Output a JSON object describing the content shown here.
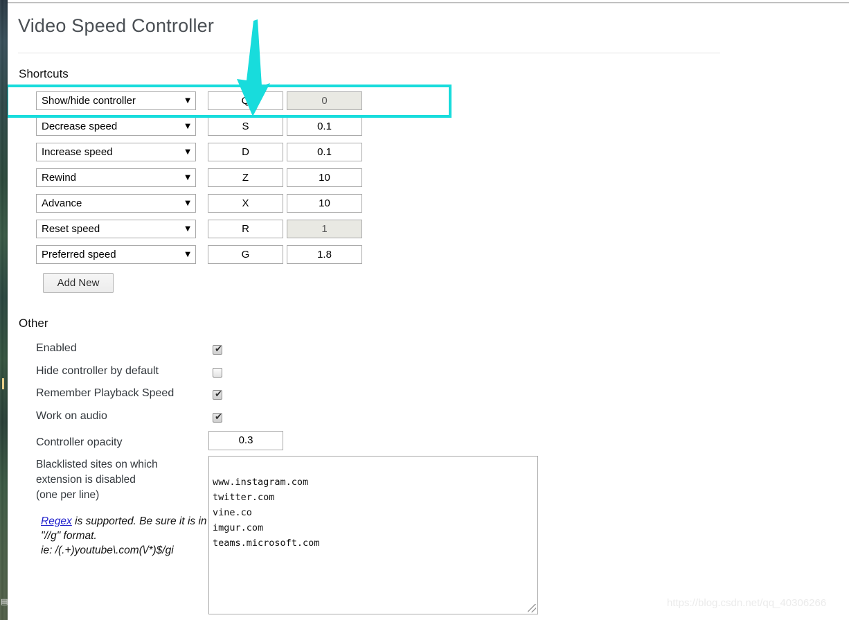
{
  "window": {
    "tab_indicator_color": "#ef5b25",
    "page_background": "#ffffff"
  },
  "header": {
    "title": "Video Speed Controller"
  },
  "sections": {
    "shortcuts_heading": "Shortcuts",
    "other_heading": "Other"
  },
  "shortcuts": {
    "add_new_label": "Add New",
    "caret_glyph": "▼",
    "rows": [
      {
        "action": "Show/hide controller",
        "key": "Q",
        "value": "0",
        "value_disabled": true,
        "highlighted": true
      },
      {
        "action": "Decrease speed",
        "key": "S",
        "value": "0.1",
        "value_disabled": false,
        "highlighted": false
      },
      {
        "action": "Increase speed",
        "key": "D",
        "value": "0.1",
        "value_disabled": false,
        "highlighted": false
      },
      {
        "action": "Rewind",
        "key": "Z",
        "value": "10",
        "value_disabled": false,
        "highlighted": false
      },
      {
        "action": "Advance",
        "key": "X",
        "value": "10",
        "value_disabled": false,
        "highlighted": false
      },
      {
        "action": "Reset speed",
        "key": "R",
        "value": "1",
        "value_disabled": true,
        "highlighted": false
      },
      {
        "action": "Preferred speed",
        "key": "G",
        "value": "1.8",
        "value_disabled": false,
        "highlighted": false
      }
    ]
  },
  "other": {
    "checkboxes": [
      {
        "label": "Enabled",
        "checked": true
      },
      {
        "label": "Hide controller by default",
        "checked": false
      },
      {
        "label": "Remember Playback Speed",
        "checked": true
      },
      {
        "label": "Work on audio",
        "checked": true
      }
    ],
    "tick_glyph": "✔",
    "opacity": {
      "label": "Controller opacity",
      "value": "0.3"
    },
    "blacklist": {
      "label": "Blacklisted sites on which extension is disabled (one per line)",
      "note_link": "Regex",
      "note_rest": " is supported. Be sure it is in \"//g\" format.\nie: /(.+)youtube\\.com(\\/*)$/gi",
      "value": "www.instagram.com\ntwitter.com\nvine.co\nimgur.com\nteams.microsoft.com"
    }
  },
  "annotation": {
    "color": "#18dcdc",
    "highlight_target": "Show/hide controller row",
    "arrow_target": "Q key field"
  },
  "watermark": {
    "text": "https://blog.csdn.net/qq_40306266"
  }
}
